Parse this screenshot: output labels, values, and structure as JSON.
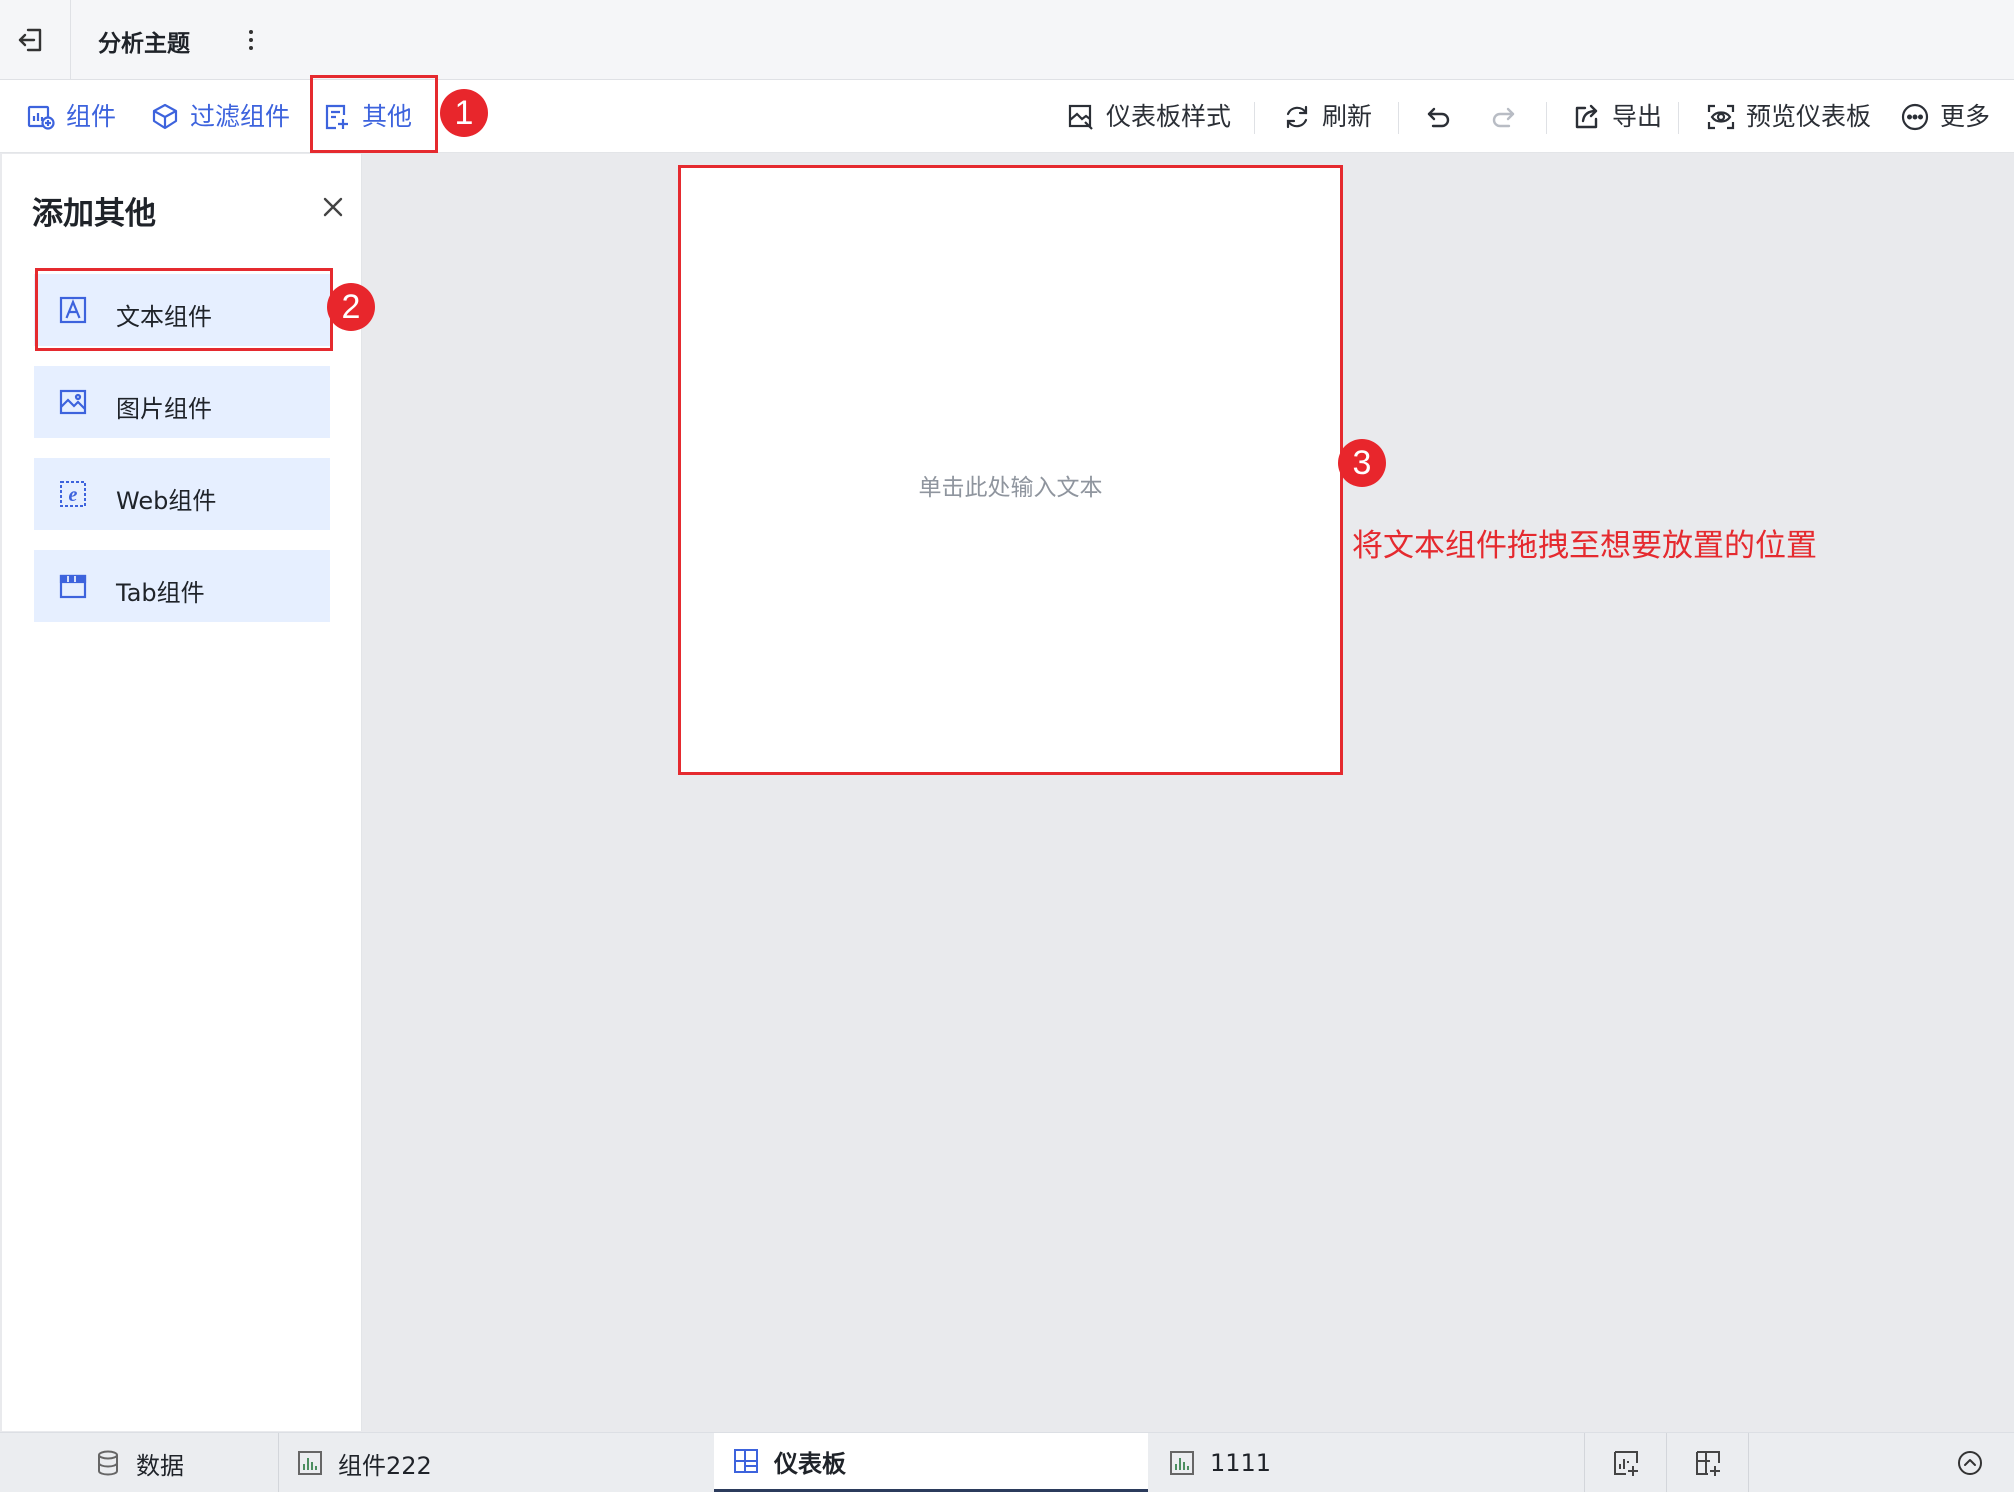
{
  "header": {
    "title": "分析主题"
  },
  "toolbar": {
    "left": [
      {
        "label": "组件",
        "icon": "add-chart-icon"
      },
      {
        "label": "过滤组件",
        "icon": "filter-component-icon"
      },
      {
        "label": "其他",
        "icon": "add-other-icon"
      }
    ],
    "right": {
      "style_label": "仪表板样式",
      "refresh_label": "刷新",
      "export_label": "导出",
      "preview_label": "预览仪表板",
      "more_label": "更多"
    }
  },
  "panel": {
    "title": "添加其他",
    "items": [
      {
        "label": "文本组件",
        "icon": "text-icon"
      },
      {
        "label": "图片组件",
        "icon": "image-icon"
      },
      {
        "label": "Web组件",
        "icon": "web-icon"
      },
      {
        "label": "Tab组件",
        "icon": "tab-icon"
      }
    ]
  },
  "canvas": {
    "text_placeholder": "单击此处输入文本"
  },
  "annotations": {
    "badges": [
      "1",
      "2",
      "3"
    ],
    "instruction": "将文本组件拖拽至想要放置的位置",
    "color": "#e52a2f"
  },
  "bottom_tabs": [
    {
      "label": "数据",
      "icon": "database-icon"
    },
    {
      "label": "组件222",
      "icon": "bar-chart-icon"
    },
    {
      "label": "仪表板",
      "icon": "dashboard-icon",
      "active": true
    },
    {
      "label": "1111",
      "icon": "bar-chart-icon"
    }
  ],
  "colors": {
    "accent": "#3d63dd",
    "panel_item_bg": "#e6efff",
    "canvas_bg": "#e9eaed"
  }
}
